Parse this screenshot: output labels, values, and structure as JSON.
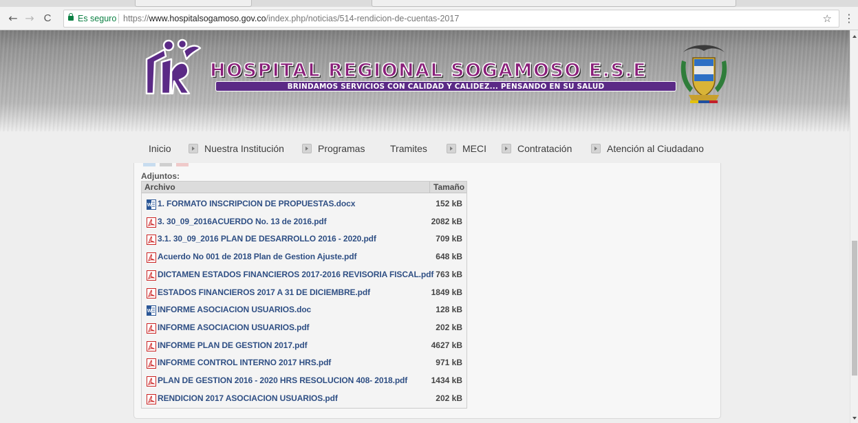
{
  "browser": {
    "back_icon": "←",
    "forward_icon": "→",
    "reload_icon": "C",
    "secure_label": "Es seguro",
    "url_scheme": "https://",
    "url_host": "www.hospitalsogamoso.gov.co",
    "url_path": "/index.php/noticias/514-rendicion-de-cuentas-2017",
    "bookmark_icon": "☆",
    "menu_icon": "⋮"
  },
  "header": {
    "title": "HOSPITAL REGIONAL SOGAMOSO E.S.E",
    "slogan": "BRINDAMOS SERVICIOS CON CALIDAD Y CALIDEZ... PENSANDO EN SU SALUD"
  },
  "nav": {
    "items": [
      {
        "label": "Inicio",
        "bullet": false
      },
      {
        "label": "Nuestra Institución",
        "bullet": true
      },
      {
        "label": "Programas",
        "bullet": true
      },
      {
        "label": "Tramites",
        "bullet": false
      },
      {
        "label": "MECI",
        "bullet": true
      },
      {
        "label": "Contratación",
        "bullet": true
      },
      {
        "label": "Atención al Ciudadano",
        "bullet": true
      }
    ]
  },
  "attachments": {
    "section_label": "Adjuntos:",
    "col_file": "Archivo",
    "col_size": "Tamaño",
    "files": [
      {
        "name": "1. FORMATO INSCRIPCION DE PROPUESTAS.docx",
        "size": "152 kB",
        "type": "word"
      },
      {
        "name": "3. 30_09_2016ACUERDO No. 13 de 2016.pdf",
        "size": "2082 kB",
        "type": "pdf"
      },
      {
        "name": "3.1. 30_09_2016 PLAN DE DESARROLLO 2016 - 2020.pdf",
        "size": "709 kB",
        "type": "pdf"
      },
      {
        "name": "Acuerdo No 001 de 2018 Plan de Gestion Ajuste.pdf",
        "size": "648 kB",
        "type": "pdf"
      },
      {
        "name": "DICTAMEN ESTADOS FINANCIEROS 2017-2016 REVISORIA FISCAL.pdf",
        "size": "763 kB",
        "type": "pdf"
      },
      {
        "name": "ESTADOS FINANCIEROS 2017 A 31 DE DICIEMBRE.pdf",
        "size": "1849 kB",
        "type": "pdf"
      },
      {
        "name": "INFORME ASOCIACION USUARIOS.doc",
        "size": "128 kB",
        "type": "word"
      },
      {
        "name": "INFORME ASOCIACION USUARIOS.pdf",
        "size": "202 kB",
        "type": "pdf"
      },
      {
        "name": "INFORME PLAN DE GESTION 2017.pdf",
        "size": "4627 kB",
        "type": "pdf"
      },
      {
        "name": "INFORME CONTROL INTERNO 2017 HRS.pdf",
        "size": "971 kB",
        "type": "pdf"
      },
      {
        "name": "PLAN DE GESTION 2016 - 2020 HRS RESOLUCION 408- 2018.pdf",
        "size": "1434 kB",
        "type": "pdf"
      },
      {
        "name": "RENDICION 2017 ASOCIACION USUARIOS.pdf",
        "size": "202 kB",
        "type": "pdf"
      }
    ]
  },
  "colors": {
    "link": "#2f4f84",
    "secure": "#0b8043",
    "brand_purple": "#5b2a86",
    "pdf_red": "#cc2222",
    "word_blue": "#2b5797"
  }
}
